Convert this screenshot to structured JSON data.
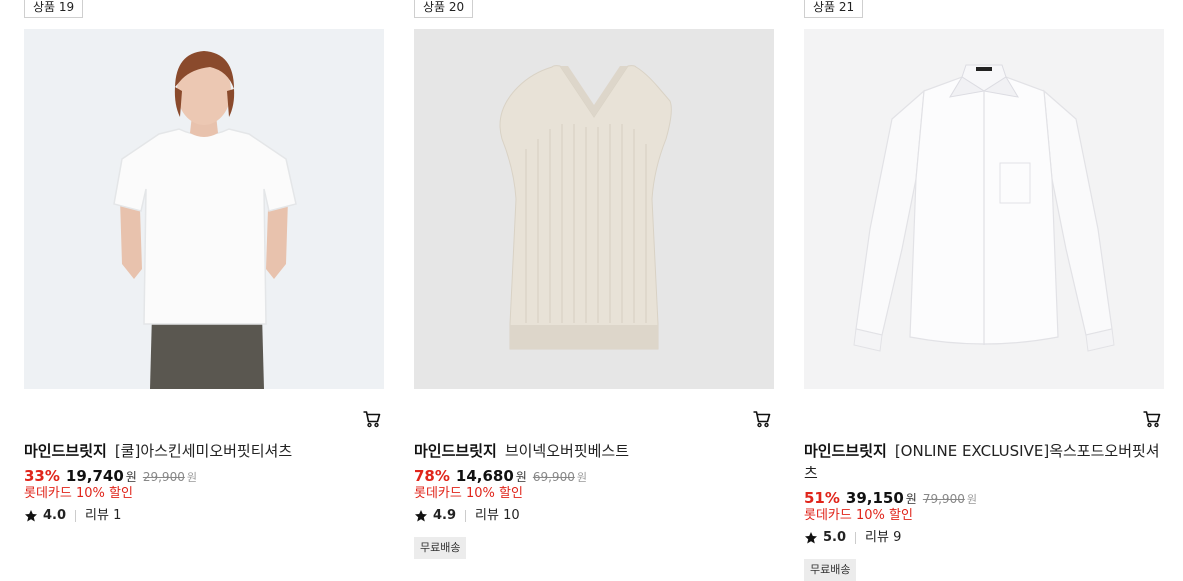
{
  "products": [
    {
      "slot_label": "상품 19",
      "brand": "마인드브릿지",
      "name": "[쿨]아스킨세미오버핏티셔츠",
      "discount": "33%",
      "price": "19,740",
      "price_unit": "원",
      "original_price": "29,900",
      "original_unit": "원",
      "card_promo": "롯데카드 10% 할인",
      "rating": "4.0",
      "reviews": "리뷰 1",
      "shipping_badge": ""
    },
    {
      "slot_label": "상품 20",
      "brand": "마인드브릿지",
      "name": "브이넥오버핏베스트",
      "discount": "78%",
      "price": "14,680",
      "price_unit": "원",
      "original_price": "69,900",
      "original_unit": "원",
      "card_promo": "롯데카드 10% 할인",
      "rating": "4.9",
      "reviews": "리뷰 10",
      "shipping_badge": "무료배송"
    },
    {
      "slot_label": "상품 21",
      "brand": "마인드브릿지",
      "name": "[ONLINE EXCLUSIVE]옥스포드오버핏셔츠",
      "discount": "51%",
      "price": "39,150",
      "price_unit": "원",
      "original_price": "79,900",
      "original_unit": "원",
      "card_promo": "롯데카드 10% 할인",
      "rating": "5.0",
      "reviews": "리뷰 9",
      "shipping_badge": "무료배송"
    }
  ],
  "icons": {
    "cart": "cart-icon",
    "star": "star-icon"
  },
  "colors": {
    "discount": "#e0251b",
    "promo": "#e0251b",
    "badge_bg": "#ececec"
  }
}
